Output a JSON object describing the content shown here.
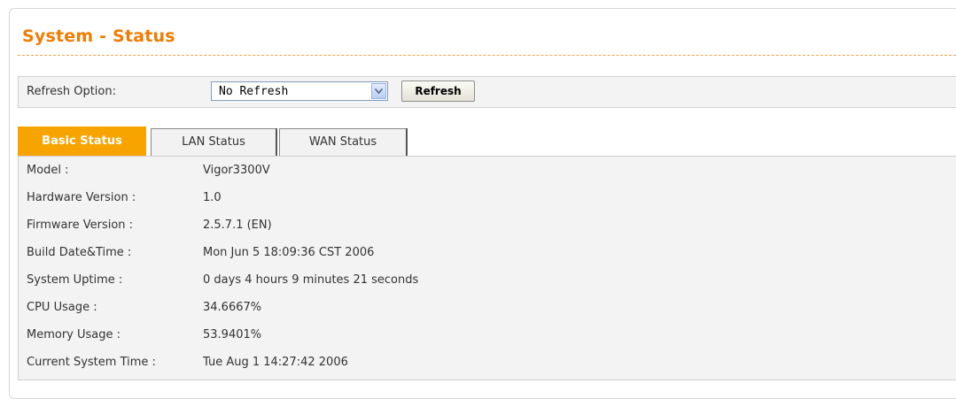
{
  "page": {
    "title": "System - Status"
  },
  "refresh": {
    "label": "Refresh Option:",
    "selected": "No Refresh",
    "button_label": "Refresh"
  },
  "tabs": [
    {
      "label": "Basic Status",
      "active": true
    },
    {
      "label": "LAN Status",
      "active": false
    },
    {
      "label": "WAN Status",
      "active": false
    }
  ],
  "status": [
    {
      "label": "Model :",
      "value": "Vigor3300V"
    },
    {
      "label": "Hardware Version :",
      "value": "1.0"
    },
    {
      "label": "Firmware Version :",
      "value": "2.5.7.1 (EN)"
    },
    {
      "label": "Build Date&Time :",
      "value": "Mon Jun 5 18:09:36 CST 2006"
    },
    {
      "label": "System Uptime :",
      "value": "0 days 4 hours 9 minutes 21 seconds"
    },
    {
      "label": "CPU Usage :",
      "value": "34.6667%"
    },
    {
      "label": "Memory Usage :",
      "value": "53.9401%"
    },
    {
      "label": "Current System Time :",
      "value": "Tue Aug 1 14:27:42 2006"
    }
  ],
  "colors": {
    "accent": "#f07c00",
    "tab_active": "#f7a400",
    "panel": "#f3f3f3"
  }
}
